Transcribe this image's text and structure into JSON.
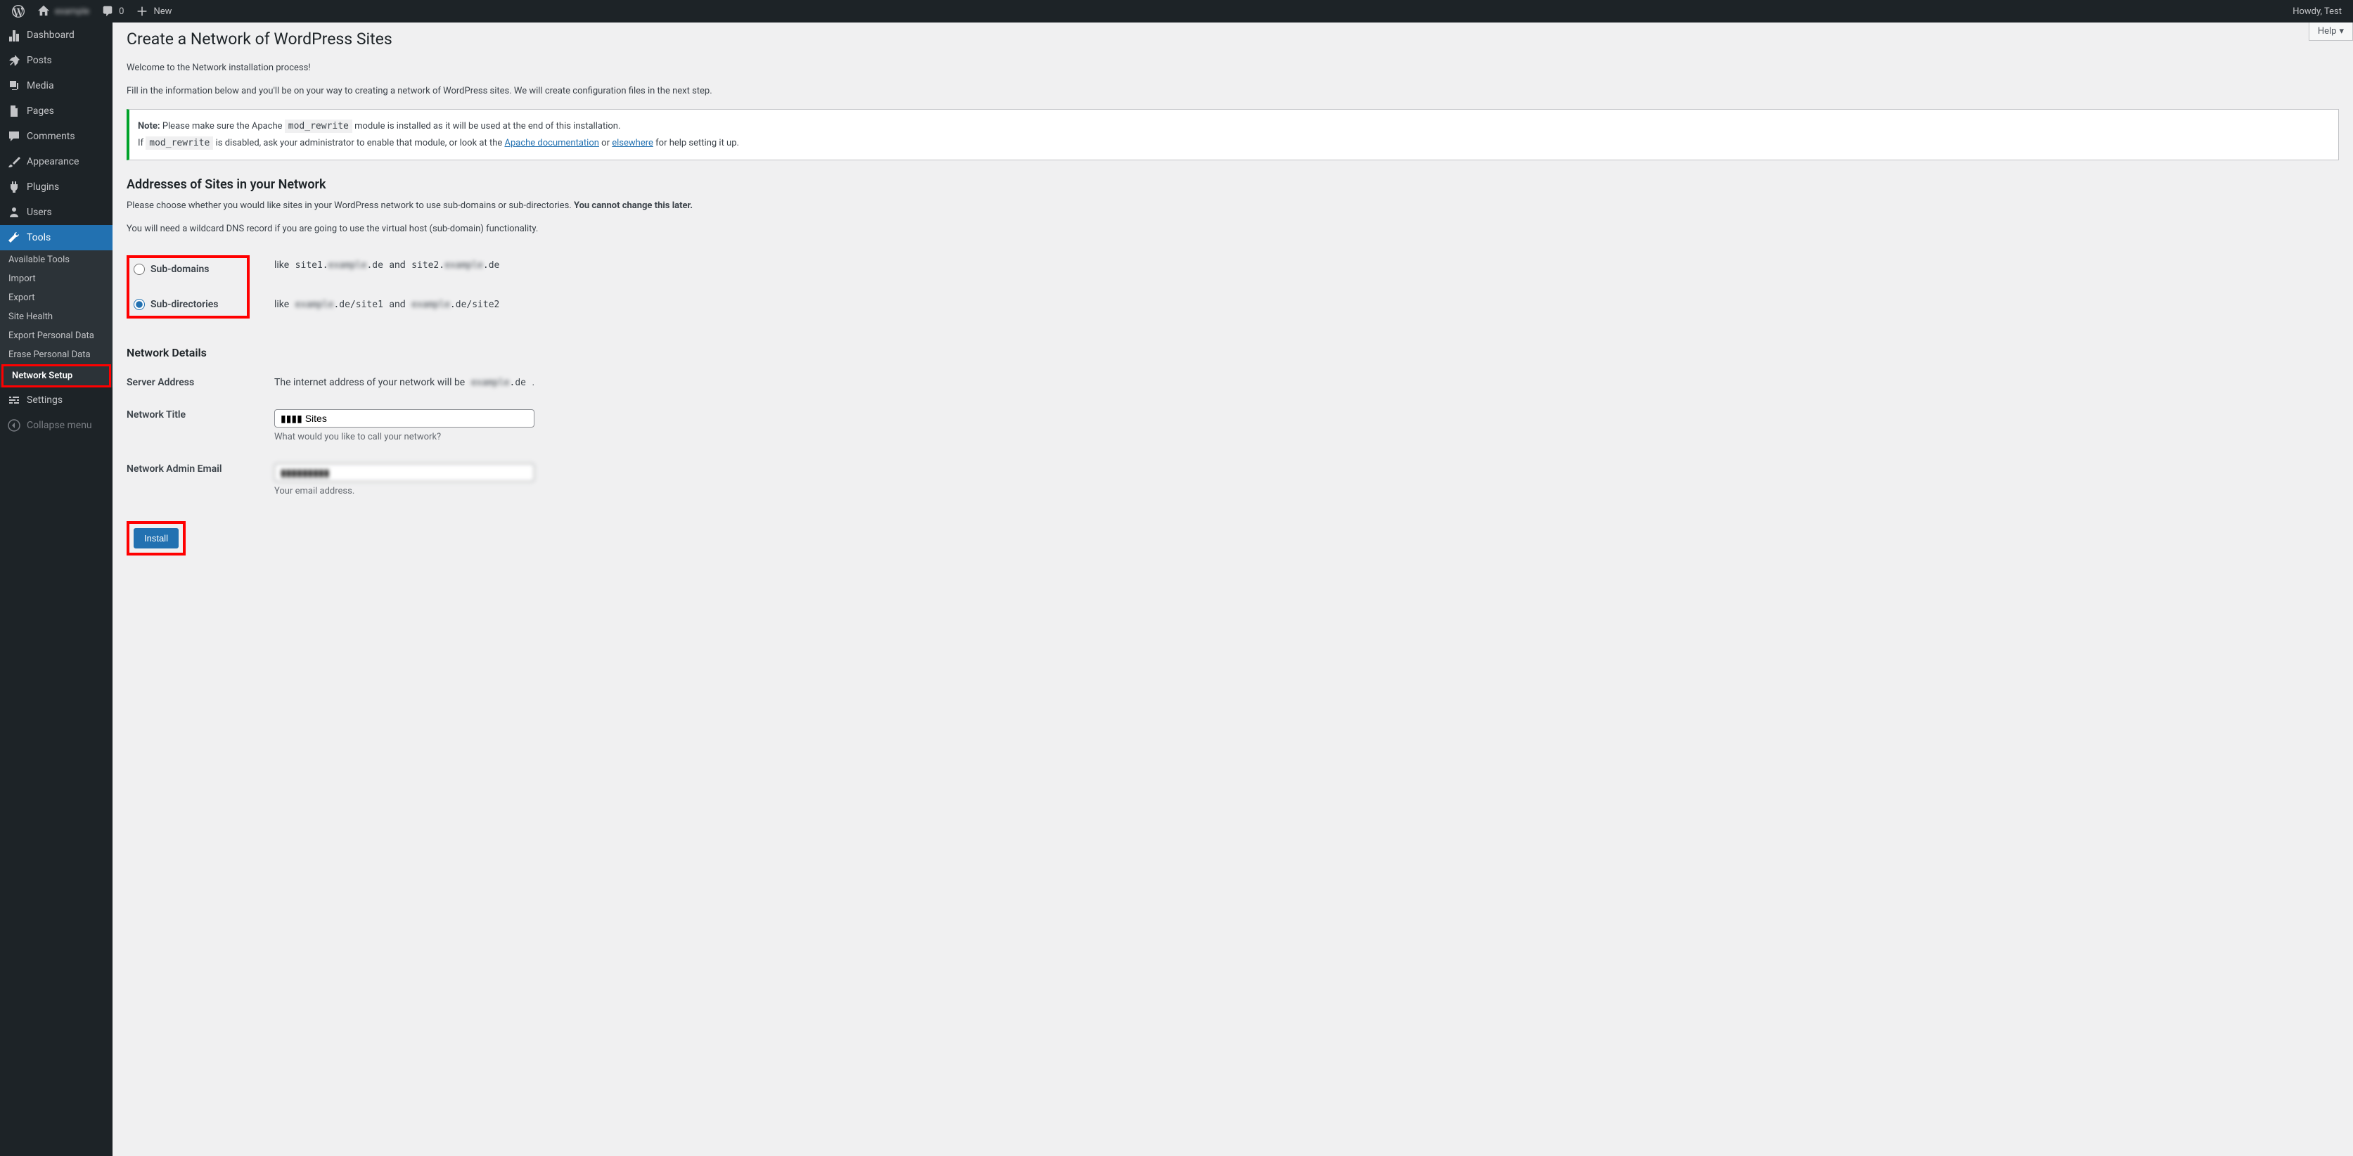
{
  "adminbar": {
    "site_name": "example",
    "comments_count": "0",
    "new_label": "New",
    "howdy": "Howdy, Test"
  },
  "sidebar": {
    "dashboard": "Dashboard",
    "posts": "Posts",
    "media": "Media",
    "pages": "Pages",
    "comments": "Comments",
    "appearance": "Appearance",
    "plugins": "Plugins",
    "users": "Users",
    "tools": "Tools",
    "tools_sub": {
      "available": "Available Tools",
      "import": "Import",
      "export": "Export",
      "site_health": "Site Health",
      "export_pd": "Export Personal Data",
      "erase_pd": "Erase Personal Data",
      "network_setup": "Network Setup"
    },
    "settings": "Settings",
    "collapse": "Collapse menu"
  },
  "help_label": "Help",
  "page": {
    "title": "Create a Network of WordPress Sites",
    "welcome": "Welcome to the Network installation process!",
    "intro": "Fill in the information below and you'll be on your way to creating a network of WordPress sites. We will create configuration files in the next step.",
    "note_label": "Note:",
    "note_text_1": " Please make sure the Apache ",
    "note_code_1": "mod_rewrite",
    "note_text_2": " module is installed as it will be used at the end of this installation.",
    "note_if_1": "If ",
    "note_if_code": "mod_rewrite",
    "note_if_2": " is disabled, ask your administrator to enable that module, or look at the ",
    "note_link_apache": "Apache documentation",
    "note_or": " or ",
    "note_link_elsewhere": "elsewhere",
    "note_if_3": " for help setting it up.",
    "addresses_heading": "Addresses of Sites in your Network",
    "addresses_p1_a": "Please choose whether you would like sites in your WordPress network to use sub-domains or sub-directories. ",
    "addresses_p1_b": "You cannot change this later.",
    "addresses_p2": "You will need a wildcard DNS record if you are going to use the virtual host (sub-domain) functionality.",
    "subdomains_label": "Sub-domains",
    "subdomains_like": "like ",
    "subdomains_ex1a": "site1.",
    "subdomains_ex1b": "example",
    "subdomains_ex1c": ".de",
    "subdomains_and": " and ",
    "subdomains_ex2a": "site2.",
    "subdomains_ex2b": "example",
    "subdomains_ex2c": ".de",
    "subdirs_label": "Sub-directories",
    "subdirs_like": "like ",
    "subdirs_ex1a": "example",
    "subdirs_ex1b": ".de/site1",
    "subdirs_and": " and ",
    "subdirs_ex2a": "example",
    "subdirs_ex2b": ".de/site2",
    "details_heading": "Network Details",
    "server_address_label": "Server Address",
    "server_address_text1": "The internet address of your network will be ",
    "server_address_code_a": "example",
    "server_address_code_b": ".de",
    "server_address_text2": " .",
    "network_title_label": "Network Title",
    "network_title_value": "▮▮▮▮ Sites",
    "network_title_desc": "What would you like to call your network?",
    "admin_email_label": "Network Admin Email",
    "admin_email_value": "▮▮▮▮▮▮▮▮▮",
    "admin_email_desc": "Your email address.",
    "install_button": "Install"
  }
}
